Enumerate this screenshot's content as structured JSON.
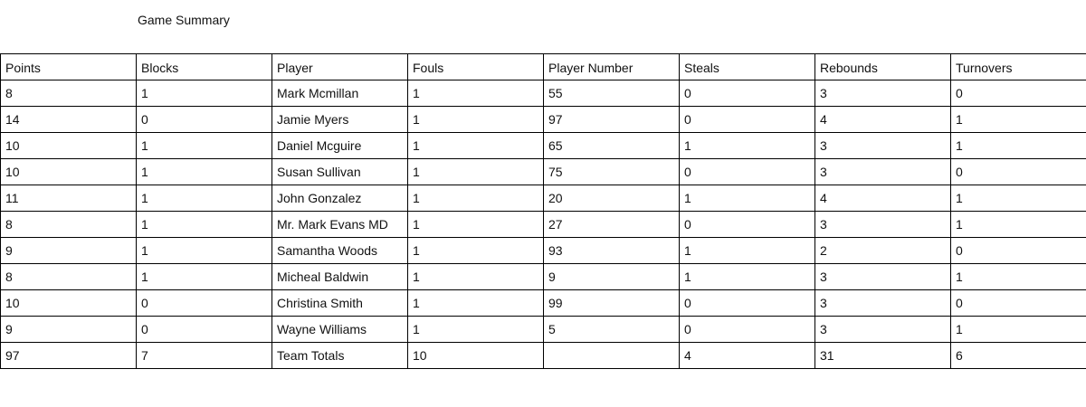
{
  "title": "Game Summary",
  "table": {
    "columns": [
      "Points",
      "Blocks",
      "Player",
      "Fouls",
      "Player Number",
      "Steals",
      "Rebounds",
      "Turnovers"
    ],
    "rows": [
      [
        "8",
        "1",
        "Mark Mcmillan",
        "1",
        "55",
        "0",
        "3",
        "0"
      ],
      [
        "14",
        "0",
        "Jamie Myers",
        "1",
        "97",
        "0",
        "4",
        "1"
      ],
      [
        "10",
        "1",
        "Daniel Mcguire",
        "1",
        "65",
        "1",
        "3",
        "1"
      ],
      [
        "10",
        "1",
        "Susan Sullivan",
        "1",
        "75",
        "0",
        "3",
        "0"
      ],
      [
        "11",
        "1",
        "John Gonzalez",
        "1",
        "20",
        "1",
        "4",
        "1"
      ],
      [
        "8",
        "1",
        "Mr. Mark Evans MD",
        "1",
        "27",
        "0",
        "3",
        "1"
      ],
      [
        "9",
        "1",
        "Samantha Woods",
        "1",
        "93",
        "1",
        "2",
        "0"
      ],
      [
        "8",
        "1",
        "Micheal Baldwin",
        "1",
        "9",
        "1",
        "3",
        "1"
      ],
      [
        "10",
        "0",
        "Christina Smith",
        "1",
        "99",
        "0",
        "3",
        "0"
      ],
      [
        "9",
        "0",
        "Wayne Williams",
        "1",
        "5",
        "0",
        "3",
        "1"
      ],
      [
        "97",
        "7",
        "Team Totals",
        "10",
        "",
        "4",
        "31",
        "6"
      ]
    ]
  }
}
